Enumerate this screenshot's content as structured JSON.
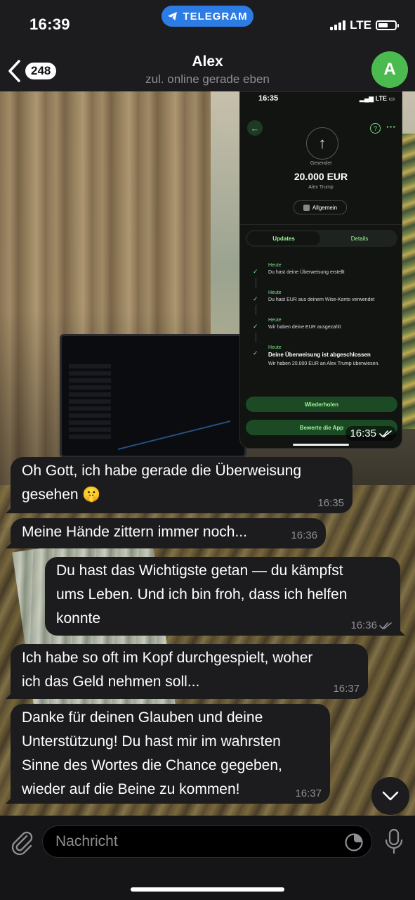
{
  "status": {
    "time": "16:39",
    "app_pill": "TELEGRAM",
    "network": "LTE",
    "battery_level": 0.6
  },
  "header": {
    "unread_count": "248",
    "title": "Alex",
    "subtitle": "zul. online gerade eben",
    "avatar_initial": "A",
    "avatar_color": "#4cbb4f"
  },
  "image_message": {
    "time": "16:35",
    "screenshot": {
      "status_time": "16:35",
      "status_network": "LTE",
      "sent_label": "Gesendet",
      "amount": "20.000 EUR",
      "recipient": "Alex Trump",
      "category_chip": "Allgemein",
      "tabs": [
        "Updates",
        "Details"
      ],
      "steps": [
        {
          "date": "Heute",
          "text": "Du hast deine Überweisung erstellt"
        },
        {
          "date": "Heute",
          "text": "Du hast EUR aus deinem Wise-Konto verwendet"
        },
        {
          "date": "Heute",
          "text": "Wir haben deine EUR ausgezahlt"
        },
        {
          "date": "Heute",
          "text": "Deine Überweisung ist abgeschlossen",
          "subtext": "Wir haben 20.000 EUR an Alex Trump überwiesen."
        }
      ],
      "button_repeat": "Wiederholen",
      "button_rate": "Bewerte die App"
    }
  },
  "messages": [
    {
      "direction": "in",
      "lines": [
        "Oh Gott, ich habe gerade die Überweisung",
        "gesehen 🤫"
      ],
      "time": "16:35"
    },
    {
      "direction": "in",
      "lines": [
        "Meine Hände zittern immer noch..."
      ],
      "time": "16:36"
    },
    {
      "direction": "out",
      "lines": [
        "Du hast das Wichtigste getan — du kämpfst",
        "ums Leben. Und ich bin froh, dass ich helfen",
        "konnte"
      ],
      "time": "16:36"
    },
    {
      "direction": "in",
      "lines": [
        "Ich habe so oft im Kopf durchgespielt, woher",
        "ich das Geld nehmen soll..."
      ],
      "time": "16:37"
    },
    {
      "direction": "in",
      "lines": [
        "Danke für deinen Glauben und deine",
        "Unterstützung! Du hast mir im wahrsten",
        "Sinne des Wortes die Chance gegeben,",
        "wieder auf die Beine zu kommen!"
      ],
      "time": "16:37"
    }
  ],
  "composer": {
    "placeholder": "Nachricht"
  },
  "icons": {
    "back": "chevron-left-icon",
    "attach": "paperclip-icon",
    "sticker": "sticker-icon",
    "mic": "microphone-icon",
    "scroll": "chevron-down-icon",
    "read": "double-check-icon"
  }
}
